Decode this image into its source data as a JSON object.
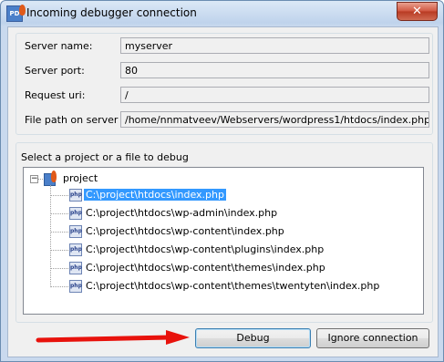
{
  "window": {
    "title": "Incoming debugger connection",
    "close_glyph": "✕",
    "app_icon_text": "PD"
  },
  "fields": [
    {
      "label": "Server name:",
      "value": "myserver"
    },
    {
      "label": "Server port:",
      "value": "80"
    },
    {
      "label": "Request uri:",
      "value": "/"
    },
    {
      "label": "File path on server",
      "value": "/home/nnmatveev/Webservers/wordpress1/htdocs/index.php"
    }
  ],
  "tree": {
    "group_label": "Select a project or a file to debug",
    "root_label": "project",
    "expander": "−",
    "file_icon_text": "php",
    "files": [
      "C:\\project\\htdocs\\index.php",
      "C:\\project\\htdocs\\wp-admin\\index.php",
      "C:\\project\\htdocs\\wp-content\\index.php",
      "C:\\project\\htdocs\\wp-content\\plugins\\index.php",
      "C:\\project\\htdocs\\wp-content\\themes\\index.php",
      "C:\\project\\htdocs\\wp-content\\themes\\twentyten\\index.php"
    ],
    "selected_index": 0
  },
  "buttons": {
    "debug": "Debug",
    "ignore": "Ignore connection"
  },
  "colors": {
    "selection": "#3399ff",
    "arrow": "#e8120c",
    "close_button": "#c9462c"
  }
}
